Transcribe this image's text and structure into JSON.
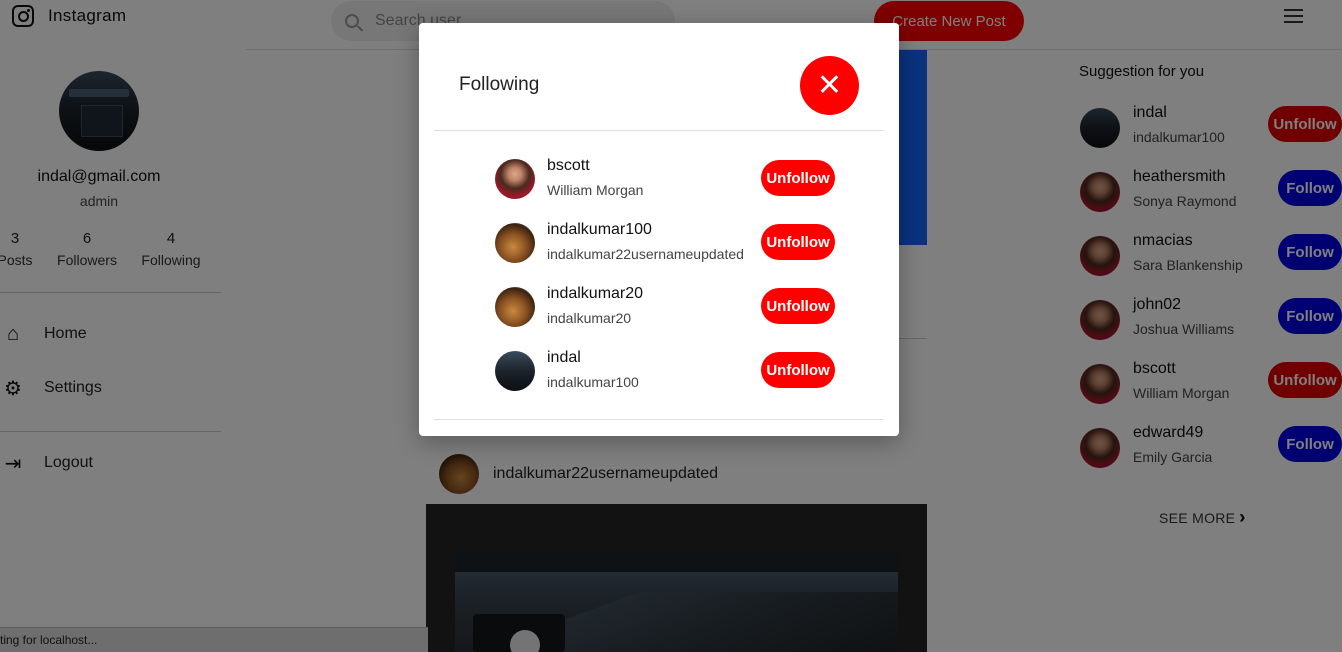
{
  "app": {
    "title": "Instagram",
    "logo_icon": "instagram-icon"
  },
  "search": {
    "placeholder": "Search user"
  },
  "header": {
    "create_label": "Create New Post",
    "menu_icon": "hamburger-menu-icon"
  },
  "profile": {
    "email": "indal@gmail.com",
    "role": "admin",
    "stats": [
      {
        "num": "3",
        "label": "Posts"
      },
      {
        "num": "6",
        "label": "Followers"
      },
      {
        "num": "4",
        "label": "Following"
      }
    ]
  },
  "nav": {
    "home": "Home",
    "settings": "Settings",
    "logout": "Logout"
  },
  "feed": {
    "post_username": "indalkumar22usernameupdated"
  },
  "suggestions": {
    "title": "Suggestion for you",
    "items": [
      {
        "name": "indal",
        "sub": "indalkumar100",
        "action": "Unfollow"
      },
      {
        "name": "heathersmith",
        "sub": "Sonya Raymond",
        "action": "Follow"
      },
      {
        "name": "nmacias",
        "sub": "Sara Blankenship",
        "action": "Follow"
      },
      {
        "name": "john02",
        "sub": "Joshua Williams",
        "action": "Follow"
      },
      {
        "name": "bscott",
        "sub": "William Morgan",
        "action": "Unfollow"
      },
      {
        "name": "edward49",
        "sub": "Emily Garcia",
        "action": "Follow"
      }
    ],
    "see_more": "SEE MORE"
  },
  "modal": {
    "title": "Following",
    "close_icon": "close-icon",
    "items": [
      {
        "name": "bscott",
        "sub": "William Morgan",
        "action": "Unfollow"
      },
      {
        "name": "indalkumar100",
        "sub": "indalkumar22usernameupdated",
        "action": "Unfollow"
      },
      {
        "name": "indalkumar20",
        "sub": "indalkumar20",
        "action": "Unfollow"
      },
      {
        "name": "indal",
        "sub": "indalkumar100",
        "action": "Unfollow"
      }
    ]
  },
  "status": {
    "text": "ting for localhost..."
  },
  "colors": {
    "accent_red": "#ff0000",
    "follow_blue": "#0000e0"
  }
}
